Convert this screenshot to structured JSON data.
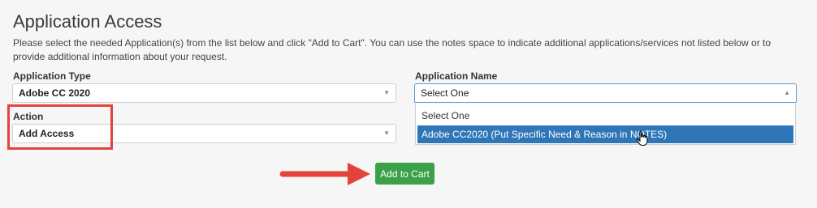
{
  "page": {
    "title": "Application Access",
    "description": "Please select the needed Application(s) from the list below and click \"Add to Cart\". You can use the notes space to indicate additional applications/services not listed below or to provide additional information about your request."
  },
  "application_type": {
    "label": "Application Type",
    "value": "Adobe CC 2020"
  },
  "application_name": {
    "label": "Application Name",
    "value": "Select One",
    "options": [
      "Select One",
      "Adobe CC2020 (Put Specific Need & Reason in NOTES)"
    ],
    "highlighted_option": 1
  },
  "action": {
    "label": "Action",
    "value": "Add Access"
  },
  "cart_button": {
    "label": "Add to Cart"
  },
  "colors": {
    "accent_blue": "#2f76b8",
    "button_green": "#3aa04a",
    "annotation_red": "#e2433b"
  }
}
